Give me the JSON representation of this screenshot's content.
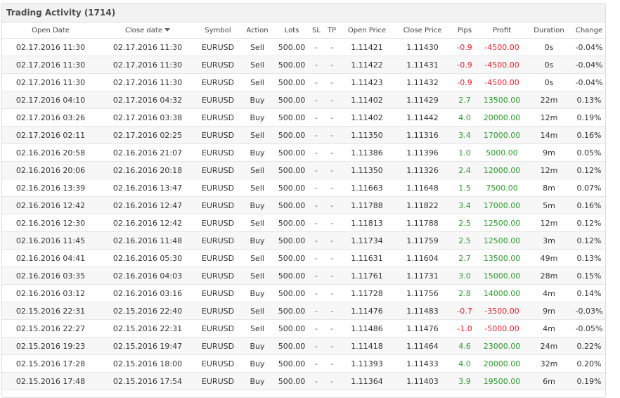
{
  "panel": {
    "title": "Trading Activity (1714)"
  },
  "columns": {
    "open_date": "Open Date",
    "close_date": "Close date",
    "symbol": "Symbol",
    "action": "Action",
    "lots": "Lots",
    "sl": "SL",
    "tp": "TP",
    "open_price": "Open Price",
    "close_price": "Close Price",
    "pips": "Pips",
    "profit": "Profit",
    "duration": "Duration",
    "change": "Change"
  },
  "colors": {
    "negative": "#e0262f",
    "positive": "#2b9a2b"
  },
  "rows": [
    {
      "open": "02.17.2016 11:30",
      "close": "02.17.2016 11:30",
      "symbol": "EURUSD",
      "action": "Sell",
      "lots": "500.00",
      "sl": "-",
      "tp": "-",
      "open_price": "1.11421",
      "close_price": "1.11430",
      "pips": "-0.9",
      "profit": "-4500.00",
      "duration": "0s",
      "change": "-0.04%"
    },
    {
      "open": "02.17.2016 11:30",
      "close": "02.17.2016 11:30",
      "symbol": "EURUSD",
      "action": "Sell",
      "lots": "500.00",
      "sl": "-",
      "tp": "-",
      "open_price": "1.11422",
      "close_price": "1.11431",
      "pips": "-0.9",
      "profit": "-4500.00",
      "duration": "0s",
      "change": "-0.04%"
    },
    {
      "open": "02.17.2016 11:30",
      "close": "02.17.2016 11:30",
      "symbol": "EURUSD",
      "action": "Sell",
      "lots": "500.00",
      "sl": "-",
      "tp": "-",
      "open_price": "1.11423",
      "close_price": "1.11432",
      "pips": "-0.9",
      "profit": "-4500.00",
      "duration": "0s",
      "change": "-0.04%"
    },
    {
      "open": "02.17.2016 04:10",
      "close": "02.17.2016 04:32",
      "symbol": "EURUSD",
      "action": "Buy",
      "lots": "500.00",
      "sl": "-",
      "tp": "-",
      "open_price": "1.11402",
      "close_price": "1.11429",
      "pips": "2.7",
      "profit": "13500.00",
      "duration": "22m",
      "change": "0.13%"
    },
    {
      "open": "02.17.2016 03:26",
      "close": "02.17.2016 03:38",
      "symbol": "EURUSD",
      "action": "Buy",
      "lots": "500.00",
      "sl": "-",
      "tp": "-",
      "open_price": "1.11402",
      "close_price": "1.11442",
      "pips": "4.0",
      "profit": "20000.00",
      "duration": "12m",
      "change": "0.19%"
    },
    {
      "open": "02.17.2016 02:11",
      "close": "02.17.2016 02:25",
      "symbol": "EURUSD",
      "action": "Sell",
      "lots": "500.00",
      "sl": "-",
      "tp": "-",
      "open_price": "1.11350",
      "close_price": "1.11316",
      "pips": "3.4",
      "profit": "17000.00",
      "duration": "14m",
      "change": "0.16%"
    },
    {
      "open": "02.16.2016 20:58",
      "close": "02.16.2016 21:07",
      "symbol": "EURUSD",
      "action": "Buy",
      "lots": "500.00",
      "sl": "-",
      "tp": "-",
      "open_price": "1.11386",
      "close_price": "1.11396",
      "pips": "1.0",
      "profit": "5000.00",
      "duration": "9m",
      "change": "0.05%"
    },
    {
      "open": "02.16.2016 20:06",
      "close": "02.16.2016 20:18",
      "symbol": "EURUSD",
      "action": "Sell",
      "lots": "500.00",
      "sl": "-",
      "tp": "-",
      "open_price": "1.11350",
      "close_price": "1.11326",
      "pips": "2.4",
      "profit": "12000.00",
      "duration": "12m",
      "change": "0.12%"
    },
    {
      "open": "02.16.2016 13:39",
      "close": "02.16.2016 13:47",
      "symbol": "EURUSD",
      "action": "Sell",
      "lots": "500.00",
      "sl": "-",
      "tp": "-",
      "open_price": "1.11663",
      "close_price": "1.11648",
      "pips": "1.5",
      "profit": "7500.00",
      "duration": "8m",
      "change": "0.07%"
    },
    {
      "open": "02.16.2016 12:42",
      "close": "02.16.2016 12:47",
      "symbol": "EURUSD",
      "action": "Buy",
      "lots": "500.00",
      "sl": "-",
      "tp": "-",
      "open_price": "1.11788",
      "close_price": "1.11822",
      "pips": "3.4",
      "profit": "17000.00",
      "duration": "5m",
      "change": "0.16%"
    },
    {
      "open": "02.16.2016 12:30",
      "close": "02.16.2016 12:42",
      "symbol": "EURUSD",
      "action": "Sell",
      "lots": "500.00",
      "sl": "-",
      "tp": "-",
      "open_price": "1.11813",
      "close_price": "1.11788",
      "pips": "2.5",
      "profit": "12500.00",
      "duration": "12m",
      "change": "0.12%"
    },
    {
      "open": "02.16.2016 11:45",
      "close": "02.16.2016 11:48",
      "symbol": "EURUSD",
      "action": "Buy",
      "lots": "500.00",
      "sl": "-",
      "tp": "-",
      "open_price": "1.11734",
      "close_price": "1.11759",
      "pips": "2.5",
      "profit": "12500.00",
      "duration": "3m",
      "change": "0.12%"
    },
    {
      "open": "02.16.2016 04:41",
      "close": "02.16.2016 05:30",
      "symbol": "EURUSD",
      "action": "Sell",
      "lots": "500.00",
      "sl": "-",
      "tp": "-",
      "open_price": "1.11631",
      "close_price": "1.11604",
      "pips": "2.7",
      "profit": "13500.00",
      "duration": "49m",
      "change": "0.13%"
    },
    {
      "open": "02.16.2016 03:35",
      "close": "02.16.2016 04:03",
      "symbol": "EURUSD",
      "action": "Sell",
      "lots": "500.00",
      "sl": "-",
      "tp": "-",
      "open_price": "1.11761",
      "close_price": "1.11731",
      "pips": "3.0",
      "profit": "15000.00",
      "duration": "28m",
      "change": "0.15%"
    },
    {
      "open": "02.16.2016 03:12",
      "close": "02.16.2016 03:16",
      "symbol": "EURUSD",
      "action": "Buy",
      "lots": "500.00",
      "sl": "-",
      "tp": "-",
      "open_price": "1.11728",
      "close_price": "1.11756",
      "pips": "2.8",
      "profit": "14000.00",
      "duration": "4m",
      "change": "0.14%"
    },
    {
      "open": "02.15.2016 22:31",
      "close": "02.15.2016 22:40",
      "symbol": "EURUSD",
      "action": "Sell",
      "lots": "500.00",
      "sl": "-",
      "tp": "-",
      "open_price": "1.11476",
      "close_price": "1.11483",
      "pips": "-0.7",
      "profit": "-3500.00",
      "duration": "9m",
      "change": "-0.03%"
    },
    {
      "open": "02.15.2016 22:27",
      "close": "02.15.2016 22:31",
      "symbol": "EURUSD",
      "action": "Sell",
      "lots": "500.00",
      "sl": "-",
      "tp": "-",
      "open_price": "1.11486",
      "close_price": "1.11476",
      "pips": "-1.0",
      "profit": "-5000.00",
      "duration": "4m",
      "change": "-0.05%"
    },
    {
      "open": "02.15.2016 19:23",
      "close": "02.15.2016 19:47",
      "symbol": "EURUSD",
      "action": "Buy",
      "lots": "500.00",
      "sl": "-",
      "tp": "-",
      "open_price": "1.11418",
      "close_price": "1.11464",
      "pips": "4.6",
      "profit": "23000.00",
      "duration": "24m",
      "change": "0.22%"
    },
    {
      "open": "02.15.2016 17:28",
      "close": "02.15.2016 18:00",
      "symbol": "EURUSD",
      "action": "Buy",
      "lots": "500.00",
      "sl": "-",
      "tp": "-",
      "open_price": "1.11393",
      "close_price": "1.11433",
      "pips": "4.0",
      "profit": "20000.00",
      "duration": "32m",
      "change": "0.20%"
    },
    {
      "open": "02.15.2016 17:48",
      "close": "02.15.2016 17:54",
      "symbol": "EURUSD",
      "action": "Buy",
      "lots": "500.00",
      "sl": "-",
      "tp": "-",
      "open_price": "1.11364",
      "close_price": "1.11403",
      "pips": "3.9",
      "profit": "19500.00",
      "duration": "6m",
      "change": "0.19%"
    }
  ]
}
